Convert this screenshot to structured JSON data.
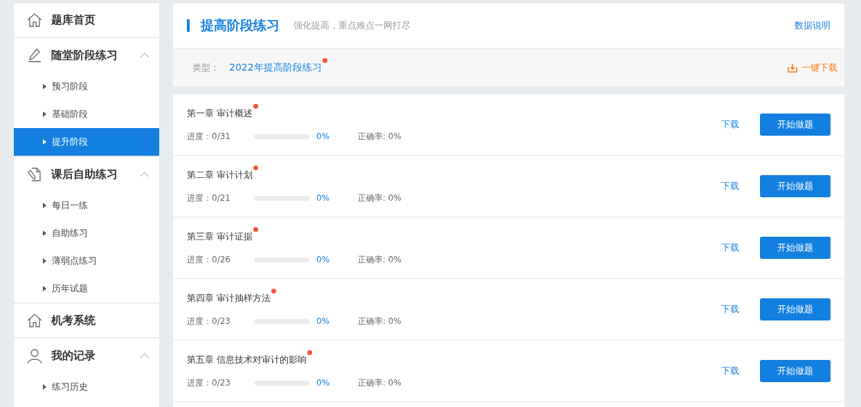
{
  "sidebar": {
    "items": [
      {
        "kind": "link",
        "label": "题库首页"
      },
      {
        "kind": "section",
        "label": "随堂阶段练习",
        "expanded": true,
        "children": [
          {
            "label": "预习阶段",
            "selected": false
          },
          {
            "label": "基础阶段",
            "selected": false
          },
          {
            "label": "提升阶段",
            "selected": true
          }
        ]
      },
      {
        "kind": "section",
        "label": "课后自助练习",
        "expanded": true,
        "children": [
          {
            "label": "每日一练",
            "selected": false
          },
          {
            "label": "自助练习",
            "selected": false
          },
          {
            "label": "薄弱点练习",
            "selected": false
          },
          {
            "label": "历年试题",
            "selected": false
          }
        ]
      },
      {
        "kind": "link",
        "label": "机考系统"
      },
      {
        "kind": "section",
        "label": "我的记录",
        "expanded": true,
        "children": [
          {
            "label": "练习历史",
            "selected": false
          }
        ]
      }
    ]
  },
  "header": {
    "title": "提高阶段练习",
    "subtitle": "强化提高，重点难点一网打尽",
    "help_link": "数据说明",
    "type_label": "类型：",
    "type_value": "2022年提高阶段练习",
    "type_new": true,
    "download_all": "一键下载"
  },
  "chapters": [
    {
      "title": "第一章 审计概述",
      "new": true,
      "progress": "进度：0/31",
      "level": 0,
      "percent": "0%",
      "accuracy": "正确率: 0%",
      "download": "下载",
      "start": "开始做题"
    },
    {
      "title": "第二章 审计计划",
      "new": true,
      "progress": "进度：0/21",
      "level": 0,
      "percent": "0%",
      "accuracy": "正确率: 0%",
      "download": "下载",
      "start": "开始做题"
    },
    {
      "title": "第三章 审计证据",
      "new": true,
      "progress": "进度：0/26",
      "level": 0,
      "percent": "0%",
      "accuracy": "正确率: 0%",
      "download": "下载",
      "start": "开始做题"
    },
    {
      "title": "第四章 审计抽样方法",
      "new": true,
      "progress": "进度：0/23",
      "level": 0,
      "percent": "0%",
      "accuracy": "正确率: 0%",
      "download": "下载",
      "start": "开始做题"
    },
    {
      "title": "第五章 信息技术对审计的影响",
      "new": true,
      "progress": "进度：0/23",
      "level": 0,
      "percent": "0%",
      "accuracy": "正确率: 0%",
      "download": "下载",
      "start": "开始做题"
    }
  ]
}
